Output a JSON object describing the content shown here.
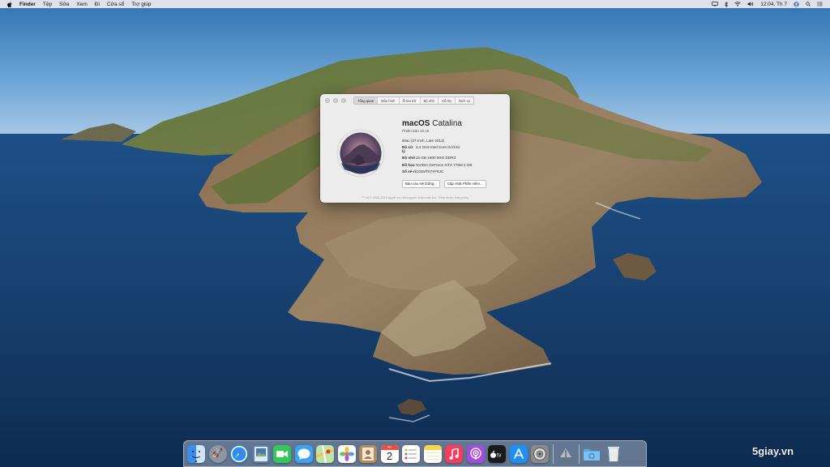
{
  "menubar": {
    "app_name": "Finder",
    "items": [
      "Tệp",
      "Sửa",
      "Xem",
      "Đi",
      "Cửa sổ",
      "Trợ giúp"
    ],
    "clock": "12:04, Th 7"
  },
  "window": {
    "tabs": [
      "Tổng quan",
      "Màn hình",
      "Ổ lưu trữ",
      "Bộ nhớ",
      "Hỗ trợ",
      "Dịch vụ"
    ],
    "os_name_bold": "macOS",
    "os_name_rest": "Catalina",
    "version": "Phiên bản 10.15",
    "model": "iMac (27-inch, Late 2013)",
    "specs": [
      {
        "label": "Bộ xử lý",
        "value": "3,4 GHz Intel Core i5 lõi tứ"
      },
      {
        "label": "Bộ nhớ",
        "value": "16 GB 1600 MHz DDR3"
      },
      {
        "label": "Đồ họa",
        "value": "NVIDIA GeForce GTX 775M 2 GB"
      },
      {
        "label": "Số sê-ri",
        "value": "C02MT57YF8JC"
      }
    ],
    "buttons": [
      "Báo cáo Hệ thống...",
      "Cập nhật Phần mềm..."
    ],
    "copyright": "™ và © 1983-2019 Apple Inc. Mọi quyền được bảo lưu. Thỏa thuận Giấy phép"
  },
  "dock": {
    "calendar_month": "TH",
    "calendar_day": "2",
    "apps": [
      {
        "name": "finder",
        "color": "#3b8eea"
      },
      {
        "name": "launchpad",
        "color": "#8a97a6"
      },
      {
        "name": "safari",
        "color": "#2d8ff0"
      },
      {
        "name": "preview",
        "color": "#5a7fb5"
      },
      {
        "name": "facetime",
        "color": "#34c759"
      },
      {
        "name": "messages",
        "color": "#3fa3f5"
      },
      {
        "name": "maps",
        "color": "#6cc46e"
      },
      {
        "name": "photos",
        "color": "#ffffff"
      },
      {
        "name": "contacts",
        "color": "#b58a5c"
      },
      {
        "name": "calendar",
        "color": "#ffffff"
      },
      {
        "name": "reminders",
        "color": "#ffffff"
      },
      {
        "name": "notes",
        "color": "#f7d54a"
      },
      {
        "name": "music",
        "color": "#fb3b5b"
      },
      {
        "name": "podcasts",
        "color": "#a34ddb"
      },
      {
        "name": "tv",
        "color": "#1a1a1a"
      },
      {
        "name": "app-store",
        "color": "#1e8ff5"
      },
      {
        "name": "system-preferences",
        "color": "#8b8b8b"
      },
      {
        "name": "airdrop-utility",
        "color": "#9aa6b2"
      },
      {
        "name": "downloads-folder",
        "color": "#58a8e8"
      },
      {
        "name": "trash",
        "color": "#e8ecef"
      }
    ]
  },
  "watermark": "5giay.vn"
}
